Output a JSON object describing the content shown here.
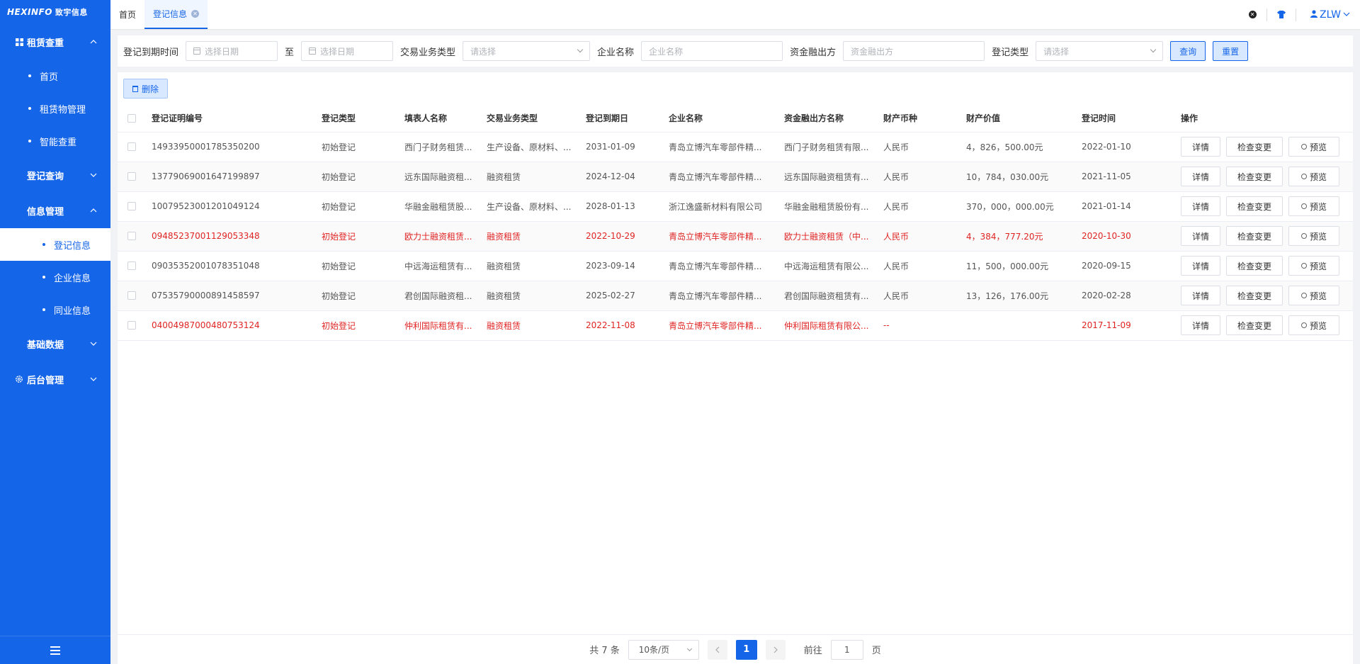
{
  "brand": {
    "name": "HEXINFO",
    "subtitle": "致宇信息"
  },
  "sidebar": {
    "groups": [
      {
        "label": "租赁查重",
        "icon": "grid-icon",
        "chevron": "up"
      },
      {
        "label": "登记查询",
        "chevron": "down"
      },
      {
        "label": "信息管理",
        "chevron": "up"
      },
      {
        "label": "基础数据",
        "chevron": "down"
      },
      {
        "label": "后台管理",
        "icon": "gear-icon",
        "chevron": "down"
      }
    ],
    "items": [
      {
        "label": "首页"
      },
      {
        "label": "租赁物管理"
      },
      {
        "label": "智能查重"
      },
      {
        "label": "登记信息",
        "active": true
      },
      {
        "label": "企业信息"
      },
      {
        "label": "同业信息"
      }
    ]
  },
  "tabs": [
    {
      "label": "首页",
      "active": false
    },
    {
      "label": "登记信息",
      "active": true
    }
  ],
  "header": {
    "user": "ZLW"
  },
  "filters": {
    "date_label": "登记到期时间",
    "date_start_placeholder": "选择日期",
    "to_label": "至",
    "date_end_placeholder": "选择日期",
    "biz_type_label": "交易业务类型",
    "biz_type_placeholder": "请选择",
    "company_label": "企业名称",
    "company_placeholder": "企业名称",
    "funder_label": "资金融出方",
    "funder_placeholder": "资金融出方",
    "reg_type_label": "登记类型",
    "reg_type_placeholder": "请选择",
    "query_button": "查询",
    "reset_button": "重置"
  },
  "toolbar": {
    "delete_button": "删除"
  },
  "table": {
    "headers": [
      "登记证明编号",
      "登记类型",
      "填表人名称",
      "交易业务类型",
      "登记到期日",
      "企业名称",
      "资金融出方名称",
      "财产币种",
      "财产价值",
      "登记时间",
      "操作"
    ],
    "actions": {
      "detail": "详情",
      "check_change": "检查变更",
      "preview": "预览"
    },
    "rows": [
      {
        "id": "14933950001785350200",
        "reg_type": "初始登记",
        "filler": "西门子财务租赁...",
        "biz_type": "生产设备、原材料、...",
        "expire": "2031-01-09",
        "company": "青岛立博汽车零部件精...",
        "funder": "西门子财务租赁有限...",
        "currency": "人民币",
        "value": "4，826，500.00元",
        "reg_time": "2022-01-10",
        "warn": false
      },
      {
        "id": "13779069001647199897",
        "reg_type": "初始登记",
        "filler": "远东国际融资租...",
        "biz_type": "融资租赁",
        "expire": "2024-12-04",
        "company": "青岛立博汽车零部件精...",
        "funder": "远东国际融资租赁有...",
        "currency": "人民币",
        "value": "10，784，030.00元",
        "reg_time": "2021-11-05",
        "warn": false
      },
      {
        "id": "10079523001201049124",
        "reg_type": "初始登记",
        "filler": "华融金融租赁股...",
        "biz_type": "生产设备、原材料、...",
        "expire": "2028-01-13",
        "company": "浙江逸盛新材料有限公司",
        "funder": "华融金融租赁股份有...",
        "currency": "人民币",
        "value": "370，000，000.00元",
        "reg_time": "2021-01-14",
        "warn": false
      },
      {
        "id": "09485237001129053348",
        "reg_type": "初始登记",
        "filler": "欧力士融资租赁...",
        "biz_type": "融资租赁",
        "expire": "2022-10-29",
        "company": "青岛立博汽车零部件精...",
        "funder": "欧力士融资租赁（中...",
        "currency": "人民币",
        "value": "4，384，777.20元",
        "reg_time": "2020-10-30",
        "warn": true
      },
      {
        "id": "09035352001078351048",
        "reg_type": "初始登记",
        "filler": "中远海运租赁有...",
        "biz_type": "融资租赁",
        "expire": "2023-09-14",
        "company": "青岛立博汽车零部件精...",
        "funder": "中远海运租赁有限公...",
        "currency": "人民币",
        "value": "11，500，000.00元",
        "reg_time": "2020-09-15",
        "warn": false
      },
      {
        "id": "07535790000891458597",
        "reg_type": "初始登记",
        "filler": "君创国际融资租...",
        "biz_type": "融资租赁",
        "expire": "2025-02-27",
        "company": "青岛立博汽车零部件精...",
        "funder": "君创国际融资租赁有...",
        "currency": "人民币",
        "value": "13，126，176.00元",
        "reg_time": "2020-02-28",
        "warn": false
      },
      {
        "id": "04004987000480753124",
        "reg_type": "初始登记",
        "filler": "仲利国际租赁有...",
        "biz_type": "融资租赁",
        "expire": "2022-11-08",
        "company": "青岛立博汽车零部件精...",
        "funder": "仲利国际租赁有限公...",
        "currency": "--",
        "value": "",
        "reg_time": "2017-11-09",
        "warn": true
      }
    ]
  },
  "pagination": {
    "total_text": "共 7 条",
    "page_size": "10条/页",
    "current_page": "1",
    "goto_label": "前往",
    "goto_value": "1",
    "page_suffix": "页"
  }
}
